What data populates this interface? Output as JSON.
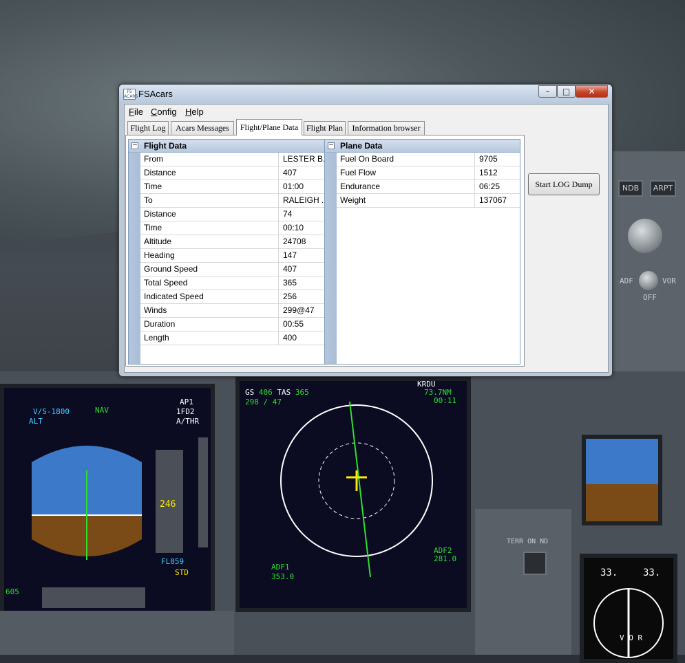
{
  "window": {
    "title": "FSAcars",
    "icon_text": "FS ACARS",
    "controls": {
      "minimize": "–",
      "maximize": "□",
      "close": "✕"
    }
  },
  "menu": [
    {
      "accel": "F",
      "rest": "ile"
    },
    {
      "accel": "C",
      "rest": "onfig"
    },
    {
      "accel": "H",
      "rest": "elp"
    }
  ],
  "tabs": [
    {
      "label": "Flight Log",
      "active": false
    },
    {
      "label": "Acars Messages",
      "active": false
    },
    {
      "label": "Flight/Plane Data",
      "active": true
    },
    {
      "label": "Flight Plan",
      "active": false
    },
    {
      "label": "Information browser",
      "active": false
    }
  ],
  "flight_data": {
    "title": "Flight Data",
    "collapse": "−",
    "rows": [
      {
        "key": "From",
        "value": "LESTER B..."
      },
      {
        "key": "Distance",
        "value": "407"
      },
      {
        "key": "Time",
        "value": "01:00"
      },
      {
        "key": "To",
        "value": "RALEIGH ..."
      },
      {
        "key": "Distance",
        "value": "74"
      },
      {
        "key": "Time",
        "value": "00:10"
      },
      {
        "key": "Altitude",
        "value": "24708"
      },
      {
        "key": "Heading",
        "value": "147"
      },
      {
        "key": "Ground Speed",
        "value": "407"
      },
      {
        "key": "Total Speed",
        "value": "365"
      },
      {
        "key": "Indicated Speed",
        "value": "256"
      },
      {
        "key": "Winds",
        "value": "299@47"
      },
      {
        "key": "Duration",
        "value": "00:55"
      },
      {
        "key": "Length",
        "value": "400"
      }
    ]
  },
  "plane_data": {
    "title": "Plane Data",
    "collapse": "−",
    "rows": [
      {
        "key": "Fuel On Board",
        "value": "9705"
      },
      {
        "key": "Fuel Flow",
        "value": "1512"
      },
      {
        "key": "Endurance",
        "value": "06:25"
      },
      {
        "key": "Weight",
        "value": "137067"
      }
    ]
  },
  "actions": {
    "start_log_dump": "Start LOG Dump"
  },
  "background": {
    "pfd": {
      "mode": "V/S-1800",
      "nav": "NAV",
      "ap": "AP1",
      "fd": "1FD2",
      "athr": "A/THR",
      "alt": "ALT",
      "speed_tag": "246",
      "fl": "FL059",
      "std": "STD",
      "baro": "605"
    },
    "nd": {
      "gs_label": "GS",
      "gs": "406",
      "tas_label": "TAS",
      "tas": "365",
      "wind": "298 / 47",
      "dest": "KRDU",
      "dist": "73.7NM",
      "eta": "00:11",
      "adf1_label": "ADF1",
      "adf1": "353.0",
      "adf2_label": "ADF2",
      "adf2": "281.0"
    },
    "labels": {
      "ndb": "NDB",
      "arpt": "ARPT",
      "adf": "ADF",
      "vor": "VOR",
      "off": "OFF",
      "terr": "TERR ON ND",
      "rmi_left": "33.",
      "rmi_right": "33.",
      "vor_letters": "V O R"
    }
  }
}
